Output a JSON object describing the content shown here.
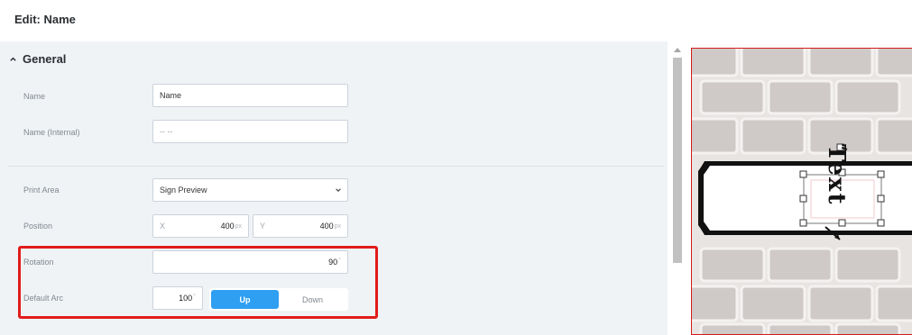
{
  "header": {
    "title": "Edit: Name"
  },
  "section": {
    "title": "General",
    "icon": "chevron-up-icon"
  },
  "fields": {
    "name": {
      "label": "Name",
      "value": "Name"
    },
    "name_internal": {
      "label": "Name (Internal)",
      "value": "-- --"
    },
    "print_area": {
      "label": "Print Area",
      "value": "Sign Preview"
    },
    "position": {
      "label": "Position",
      "x_prefix": "X",
      "x_value": "400",
      "x_unit": "px",
      "y_prefix": "Y",
      "y_value": "400",
      "y_unit": "px"
    },
    "rotation": {
      "label": "Rotation",
      "value": "90",
      "unit": "°"
    },
    "default_arc": {
      "label": "Default Arc",
      "value": "100",
      "unit": "°",
      "options": [
        "Up",
        "Down"
      ],
      "selected": "Up"
    }
  },
  "preview": {
    "text_glyphs": [
      "T",
      "e",
      "x",
      "t"
    ]
  },
  "colors": {
    "accent": "#2f9ff2",
    "highlight": "#e11b1b",
    "panel": "#f0f3f6"
  }
}
